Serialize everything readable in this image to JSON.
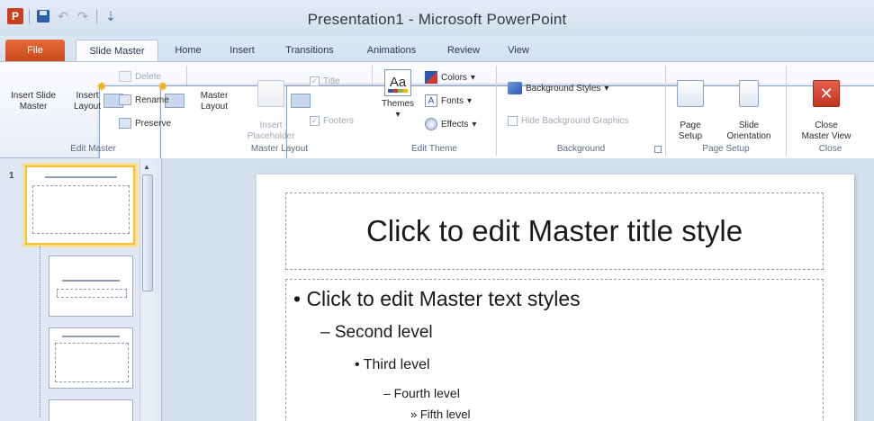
{
  "window": {
    "title": "Presentation1 - Microsoft PowerPoint"
  },
  "quick_access": {
    "logo": "P",
    "undo_icon": "↶",
    "redo_icon": "↷",
    "customize_icon": "⇣"
  },
  "tabs": [
    {
      "label": "File"
    },
    {
      "label": "Slide Master"
    },
    {
      "label": "Home"
    },
    {
      "label": "Insert"
    },
    {
      "label": "Transitions"
    },
    {
      "label": "Animations"
    },
    {
      "label": "Review"
    },
    {
      "label": "View"
    }
  ],
  "ribbon": {
    "edit_master": {
      "label": "Edit Master",
      "insert_slide_master": "Insert Slide\nMaster",
      "insert_layout": "Insert\nLayout",
      "delete": "Delete",
      "rename": "Rename",
      "preserve": "Preserve"
    },
    "master_layout": {
      "label": "Master Layout",
      "master_layout": "Master\nLayout",
      "insert_placeholder": "Insert\nPlaceholder",
      "title": "Title",
      "footers": "Footers"
    },
    "edit_theme": {
      "label": "Edit Theme",
      "themes": "Themes",
      "themes_icon": "Aa",
      "colors": "Colors",
      "fonts": "Fonts",
      "effects": "Effects"
    },
    "background": {
      "label": "Background",
      "background_styles": "Background Styles",
      "hide_background_graphics": "Hide Background Graphics"
    },
    "page_setup": {
      "label": "Page Setup",
      "page_setup": "Page\nSetup",
      "slide_orientation": "Slide\nOrientation"
    },
    "close": {
      "label": "Close",
      "close_master_view": "Close\nMaster View",
      "close_icon": "✕"
    }
  },
  "thumbnails": {
    "selected_number": "1"
  },
  "slide": {
    "title_placeholder": "Click to edit Master title style",
    "levels": [
      "•  Click to edit Master text styles",
      "– Second level",
      "• Third level",
      "– Fourth level",
      "» Fifth level"
    ]
  },
  "colors": {
    "file_tab": "#c94a1c",
    "accent": "#2a58b0",
    "selection": "#f3c13a"
  }
}
